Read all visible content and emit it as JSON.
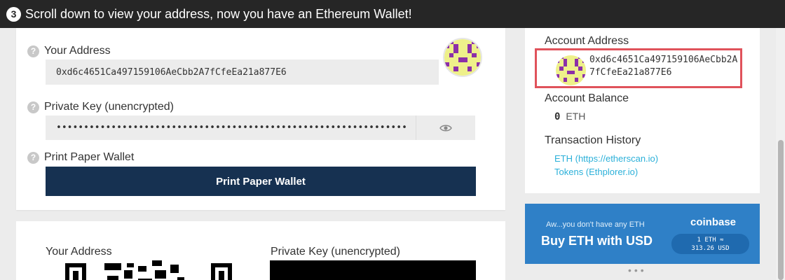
{
  "banner": {
    "step": "3",
    "text": "Scroll down to view your address, now you have an Ethereum Wallet!"
  },
  "wallet": {
    "address_label": "Your Address",
    "address": "0xd6c4651Ca497159106AeCbb2A7fCfeEa21a877E6",
    "private_key_label": "Private Key (unencrypted)",
    "private_key_masked": "••••••••••••••••••••••••••••••••••••••••••••••••••••••••••••••••",
    "print_label": "Print Paper Wallet",
    "help_icon": "?",
    "eye_icon": "eye-icon"
  },
  "paper": {
    "address_label": "Your Address",
    "private_key_label": "Private Key (unencrypted)"
  },
  "sidebar": {
    "account_address_label": "Account Address",
    "account_address": "0xd6c4651Ca497159106AeCbb2A7fCfeEa21a877E6",
    "account_balance_label": "Account Balance",
    "balance_value": "0",
    "balance_unit": "ETH",
    "history_label": "Transaction History",
    "links": [
      "ETH (https://etherscan.io)",
      "Tokens (Ethplorer.io)"
    ]
  },
  "coinbase": {
    "small_text": "Aw...you don't have any ETH",
    "big_text": "Buy ETH with USD",
    "logo": "coinbase",
    "rate_line1": "1 ETH ≈",
    "rate_line2": "313.26 USD"
  },
  "colors": {
    "banner_bg": "#262626",
    "print_button": "#163151",
    "highlight_border": "#e0525b",
    "link": "#2bb0d9",
    "coinbase_bg": "#2f80c7",
    "identicon_purple": "#8c2fa8",
    "identicon_yellow": "#eef08a"
  }
}
